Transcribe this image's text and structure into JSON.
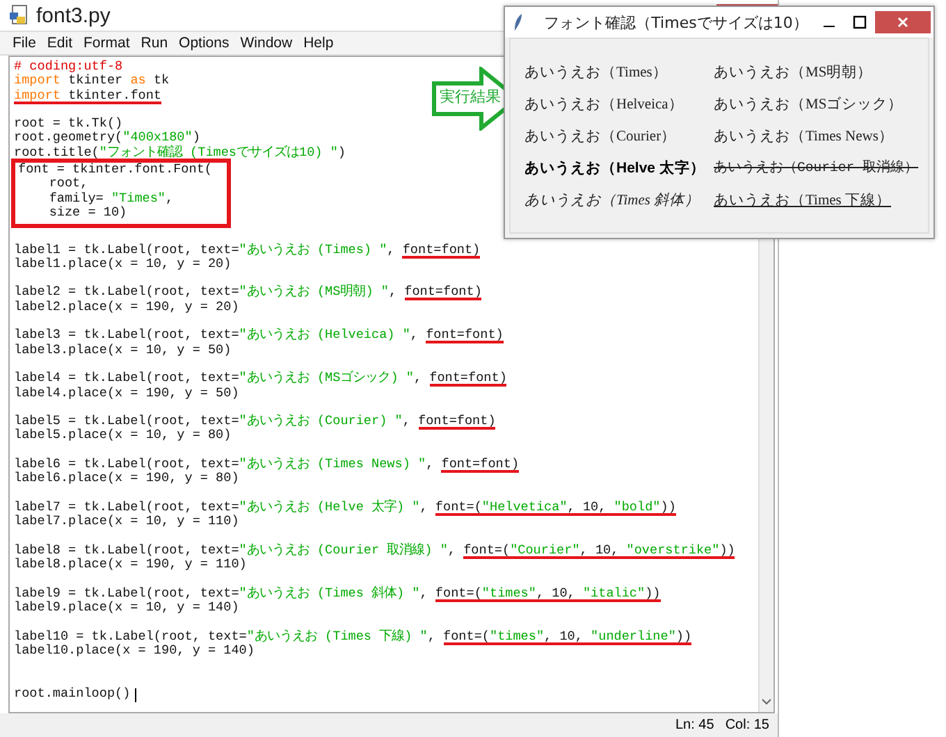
{
  "editor": {
    "title": "font3.py",
    "menu": [
      "File",
      "Edit",
      "Format",
      "Run",
      "Options",
      "Window",
      "Help"
    ],
    "blocks": [
      {
        "boxed": false,
        "lines": [
          {
            "kind": "code",
            "segments": [
              {
                "underlined": false,
                "tokens": [
                  {
                    "kind": "comment",
                    "text": "# coding:utf-8"
                  }
                ]
              }
            ]
          },
          {
            "kind": "code",
            "segments": [
              {
                "underlined": false,
                "tokens": [
                  {
                    "kind": "keyword",
                    "text": "import"
                  },
                  {
                    "kind": "text",
                    "text": " tkinter "
                  },
                  {
                    "kind": "keyword",
                    "text": "as"
                  },
                  {
                    "kind": "text",
                    "text": " tk"
                  }
                ]
              }
            ]
          },
          {
            "kind": "code",
            "segments": [
              {
                "underlined": true,
                "tokens": [
                  {
                    "kind": "keyword",
                    "text": "import"
                  },
                  {
                    "kind": "text",
                    "text": " tkinter.font"
                  }
                ]
              }
            ]
          },
          {
            "kind": "blank"
          },
          {
            "kind": "code",
            "segments": [
              {
                "underlined": false,
                "tokens": [
                  {
                    "kind": "text",
                    "text": "root = tk.Tk()"
                  }
                ]
              }
            ]
          },
          {
            "kind": "code",
            "segments": [
              {
                "underlined": false,
                "tokens": [
                  {
                    "kind": "text",
                    "text": "root.geometry("
                  },
                  {
                    "kind": "string",
                    "text": "\"400x180\""
                  },
                  {
                    "kind": "text",
                    "text": ")"
                  }
                ]
              }
            ]
          },
          {
            "kind": "code",
            "segments": [
              {
                "underlined": false,
                "tokens": [
                  {
                    "kind": "text",
                    "text": "root.title("
                  },
                  {
                    "kind": "string",
                    "text": "\"フォント確認 (Timesでサイズは10) \""
                  },
                  {
                    "kind": "text",
                    "text": ")"
                  }
                ]
              }
            ]
          }
        ]
      },
      {
        "boxed": true,
        "lines": [
          {
            "kind": "code",
            "segments": [
              {
                "underlined": false,
                "tokens": [
                  {
                    "kind": "text",
                    "text": "font = tkinter.font.Font("
                  }
                ]
              }
            ]
          },
          {
            "kind": "code",
            "segments": [
              {
                "underlined": false,
                "tokens": [
                  {
                    "kind": "text",
                    "text": "    root,"
                  }
                ]
              }
            ]
          },
          {
            "kind": "code",
            "segments": [
              {
                "underlined": false,
                "tokens": [
                  {
                    "kind": "text",
                    "text": "    family= "
                  },
                  {
                    "kind": "string",
                    "text": "\"Times\""
                  },
                  {
                    "kind": "text",
                    "text": ","
                  }
                ]
              }
            ]
          },
          {
            "kind": "code",
            "segments": [
              {
                "underlined": false,
                "tokens": [
                  {
                    "kind": "text",
                    "text": "    size = 10)"
                  }
                ]
              }
            ]
          }
        ]
      },
      {
        "boxed": false,
        "lines": [
          {
            "kind": "blank"
          },
          {
            "kind": "code",
            "segments": [
              {
                "underlined": false,
                "tokens": [
                  {
                    "kind": "text",
                    "text": "label1 = tk.Label(root, text="
                  },
                  {
                    "kind": "string",
                    "text": "\"あいうえお (Times) \""
                  },
                  {
                    "kind": "text",
                    "text": ", "
                  }
                ]
              },
              {
                "underlined": true,
                "tokens": [
                  {
                    "kind": "text",
                    "text": "font=font)"
                  }
                ]
              }
            ]
          },
          {
            "kind": "code",
            "segments": [
              {
                "underlined": false,
                "tokens": [
                  {
                    "kind": "text",
                    "text": "label1.place(x = 10, y = 20)"
                  }
                ]
              }
            ]
          },
          {
            "kind": "blank"
          },
          {
            "kind": "code",
            "segments": [
              {
                "underlined": false,
                "tokens": [
                  {
                    "kind": "text",
                    "text": "label2 = tk.Label(root, text="
                  },
                  {
                    "kind": "string",
                    "text": "\"あいうえお (MS明朝) \""
                  },
                  {
                    "kind": "text",
                    "text": ", "
                  }
                ]
              },
              {
                "underlined": true,
                "tokens": [
                  {
                    "kind": "text",
                    "text": "font=font)"
                  }
                ]
              }
            ]
          },
          {
            "kind": "code",
            "segments": [
              {
                "underlined": false,
                "tokens": [
                  {
                    "kind": "text",
                    "text": "label2.place(x = 190, y = 20)"
                  }
                ]
              }
            ]
          },
          {
            "kind": "blank"
          },
          {
            "kind": "code",
            "segments": [
              {
                "underlined": false,
                "tokens": [
                  {
                    "kind": "text",
                    "text": "label3 = tk.Label(root, text="
                  },
                  {
                    "kind": "string",
                    "text": "\"あいうえお (Helveica) \""
                  },
                  {
                    "kind": "text",
                    "text": ", "
                  }
                ]
              },
              {
                "underlined": true,
                "tokens": [
                  {
                    "kind": "text",
                    "text": "font=font)"
                  }
                ]
              }
            ]
          },
          {
            "kind": "code",
            "segments": [
              {
                "underlined": false,
                "tokens": [
                  {
                    "kind": "text",
                    "text": "label3.place(x = 10, y = 50)"
                  }
                ]
              }
            ]
          },
          {
            "kind": "blank"
          },
          {
            "kind": "code",
            "segments": [
              {
                "underlined": false,
                "tokens": [
                  {
                    "kind": "text",
                    "text": "label4 = tk.Label(root, text="
                  },
                  {
                    "kind": "string",
                    "text": "\"あいうえお (MSゴシック) \""
                  },
                  {
                    "kind": "text",
                    "text": ", "
                  }
                ]
              },
              {
                "underlined": true,
                "tokens": [
                  {
                    "kind": "text",
                    "text": "font=font)"
                  }
                ]
              }
            ]
          },
          {
            "kind": "code",
            "segments": [
              {
                "underlined": false,
                "tokens": [
                  {
                    "kind": "text",
                    "text": "label4.place(x = 190, y = 50)"
                  }
                ]
              }
            ]
          },
          {
            "kind": "blank"
          },
          {
            "kind": "code",
            "segments": [
              {
                "underlined": false,
                "tokens": [
                  {
                    "kind": "text",
                    "text": "label5 = tk.Label(root, text="
                  },
                  {
                    "kind": "string",
                    "text": "\"あいうえお (Courier) \""
                  },
                  {
                    "kind": "text",
                    "text": ", "
                  }
                ]
              },
              {
                "underlined": true,
                "tokens": [
                  {
                    "kind": "text",
                    "text": "font=font)"
                  }
                ]
              }
            ]
          },
          {
            "kind": "code",
            "segments": [
              {
                "underlined": false,
                "tokens": [
                  {
                    "kind": "text",
                    "text": "label5.place(x = 10, y = 80)"
                  }
                ]
              }
            ]
          },
          {
            "kind": "blank"
          },
          {
            "kind": "code",
            "segments": [
              {
                "underlined": false,
                "tokens": [
                  {
                    "kind": "text",
                    "text": "label6 = tk.Label(root, text="
                  },
                  {
                    "kind": "string",
                    "text": "\"あいうえお (Times News) \""
                  },
                  {
                    "kind": "text",
                    "text": ", "
                  }
                ]
              },
              {
                "underlined": true,
                "tokens": [
                  {
                    "kind": "text",
                    "text": "font=font)"
                  }
                ]
              }
            ]
          },
          {
            "kind": "code",
            "segments": [
              {
                "underlined": false,
                "tokens": [
                  {
                    "kind": "text",
                    "text": "label6.place(x = 190, y = 80)"
                  }
                ]
              }
            ]
          },
          {
            "kind": "blank"
          },
          {
            "kind": "code",
            "segments": [
              {
                "underlined": false,
                "tokens": [
                  {
                    "kind": "text",
                    "text": "label7 = tk.Label(root, text="
                  },
                  {
                    "kind": "string",
                    "text": "\"あいうえお (Helve 太字) \""
                  },
                  {
                    "kind": "text",
                    "text": ", "
                  }
                ]
              },
              {
                "underlined": true,
                "tokens": [
                  {
                    "kind": "text",
                    "text": "font=("
                  },
                  {
                    "kind": "string",
                    "text": "\"Helvetica\""
                  },
                  {
                    "kind": "text",
                    "text": ", 10, "
                  },
                  {
                    "kind": "string",
                    "text": "\"bold\""
                  },
                  {
                    "kind": "text",
                    "text": "))"
                  }
                ]
              }
            ]
          },
          {
            "kind": "code",
            "segments": [
              {
                "underlined": false,
                "tokens": [
                  {
                    "kind": "text",
                    "text": "label7.place(x = 10, y = 110)"
                  }
                ]
              }
            ]
          },
          {
            "kind": "blank"
          },
          {
            "kind": "code",
            "segments": [
              {
                "underlined": false,
                "tokens": [
                  {
                    "kind": "text",
                    "text": "label8 = tk.Label(root, text="
                  },
                  {
                    "kind": "string",
                    "text": "\"あいうえお (Courier 取消線) \""
                  },
                  {
                    "kind": "text",
                    "text": ", "
                  }
                ]
              },
              {
                "underlined": true,
                "tokens": [
                  {
                    "kind": "text",
                    "text": "font=("
                  },
                  {
                    "kind": "string",
                    "text": "\"Courier\""
                  },
                  {
                    "kind": "text",
                    "text": ", 10, "
                  },
                  {
                    "kind": "string",
                    "text": "\"overstrike\""
                  },
                  {
                    "kind": "text",
                    "text": "))"
                  }
                ]
              }
            ]
          },
          {
            "kind": "code",
            "segments": [
              {
                "underlined": false,
                "tokens": [
                  {
                    "kind": "text",
                    "text": "label8.place(x = 190, y = 110)"
                  }
                ]
              }
            ]
          },
          {
            "kind": "blank"
          },
          {
            "kind": "code",
            "segments": [
              {
                "underlined": false,
                "tokens": [
                  {
                    "kind": "text",
                    "text": "label9 = tk.Label(root, text="
                  },
                  {
                    "kind": "string",
                    "text": "\"あいうえお (Times 斜体) \""
                  },
                  {
                    "kind": "text",
                    "text": ", "
                  }
                ]
              },
              {
                "underlined": true,
                "tokens": [
                  {
                    "kind": "text",
                    "text": "font=("
                  },
                  {
                    "kind": "string",
                    "text": "\"times\""
                  },
                  {
                    "kind": "text",
                    "text": ", 10, "
                  },
                  {
                    "kind": "string",
                    "text": "\"italic\""
                  },
                  {
                    "kind": "text",
                    "text": "))"
                  }
                ]
              }
            ]
          },
          {
            "kind": "code",
            "segments": [
              {
                "underlined": false,
                "tokens": [
                  {
                    "kind": "text",
                    "text": "label9.place(x = 10, y = 140)"
                  }
                ]
              }
            ]
          },
          {
            "kind": "blank"
          },
          {
            "kind": "code",
            "segments": [
              {
                "underlined": false,
                "tokens": [
                  {
                    "kind": "text",
                    "text": "label10 = tk.Label(root, text="
                  },
                  {
                    "kind": "string",
                    "text": "\"あいうえお (Times 下線) \""
                  },
                  {
                    "kind": "text",
                    "text": ", "
                  }
                ]
              },
              {
                "underlined": true,
                "tokens": [
                  {
                    "kind": "text",
                    "text": "font=("
                  },
                  {
                    "kind": "string",
                    "text": "\"times\""
                  },
                  {
                    "kind": "text",
                    "text": ", 10, "
                  },
                  {
                    "kind": "string",
                    "text": "\"underline\""
                  },
                  {
                    "kind": "text",
                    "text": "))"
                  }
                ]
              }
            ]
          },
          {
            "kind": "code",
            "segments": [
              {
                "underlined": false,
                "tokens": [
                  {
                    "kind": "text",
                    "text": "label10.place(x = 190, y = 140)"
                  }
                ]
              }
            ]
          },
          {
            "kind": "blank"
          },
          {
            "kind": "blank"
          },
          {
            "kind": "code",
            "segments": [
              {
                "underlined": false,
                "tokens": [
                  {
                    "kind": "text",
                    "text": "root.mainloop()"
                  }
                ]
              }
            ]
          }
        ]
      }
    ],
    "status_bar": {
      "line": "Ln: 45",
      "column": "Col: 15"
    }
  },
  "callout": {
    "label": "実行結果"
  },
  "result_window": {
    "title": "フォント確認（Timesでサイズは10）",
    "labels": [
      {
        "kind": "regular",
        "text": "あいうえお（Times）"
      },
      {
        "kind": "regular",
        "text": "あいうえお（MS明朝）"
      },
      {
        "kind": "regular",
        "text": "あいうえお（Helveica）"
      },
      {
        "kind": "regular",
        "text": "あいうえお（MSゴシック）"
      },
      {
        "kind": "regular",
        "text": "あいうえお（Courier）"
      },
      {
        "kind": "regular",
        "text": "あいうえお（Times News）"
      },
      {
        "kind": "bold",
        "text": "あいうえお（Helve 太字）"
      },
      {
        "kind": "overstrike",
        "text": "あいうえお（Courier 取消線）"
      },
      {
        "kind": "italic",
        "text": "あいうえお（Times 斜体）"
      },
      {
        "kind": "underline",
        "text": "あいうえお（Times 下線）"
      }
    ]
  }
}
